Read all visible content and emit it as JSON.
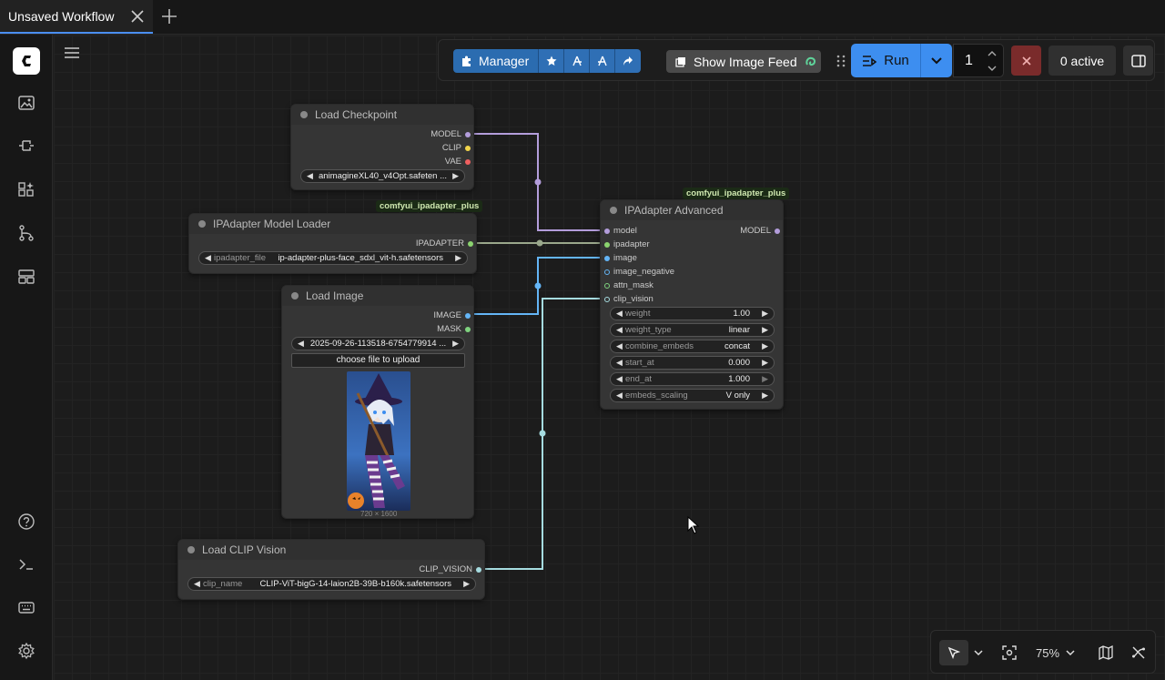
{
  "tab": {
    "title": "Unsaved Workflow"
  },
  "toolbar": {
    "manager_label": "Manager",
    "feed_label": "Show Image Feed",
    "run_label": "Run",
    "run_count": "1",
    "active_label": "0 active"
  },
  "zoom": {
    "label": "75%"
  },
  "nodes": {
    "checkpoint": {
      "title": "Load Checkpoint",
      "outputs": [
        "MODEL",
        "CLIP",
        "VAE"
      ],
      "ckpt_value": "animagineXL40_v4Opt.safeten ..."
    },
    "ipa_loader": {
      "badge": "comfyui_ipadapter_plus",
      "title": "IPAdapter Model Loader",
      "output": "IPADAPTER",
      "widget_name": "ipadapter_file",
      "widget_value": "ip-adapter-plus-face_sdxl_vit-h.safetensors"
    },
    "load_image": {
      "title": "Load Image",
      "outputs": [
        "IMAGE",
        "MASK"
      ],
      "file_value": "2025-09-26-113518-6754779914 ...",
      "upload_label": "choose file to upload",
      "image_size": "720 × 1600"
    },
    "clip_vision": {
      "title": "Load CLIP Vision",
      "output": "CLIP_VISION",
      "widget_name": "clip_name",
      "widget_value": "CLIP-ViT-bigG-14-laion2B-39B-b160k.safetensors"
    },
    "ipa_advanced": {
      "badge": "comfyui_ipadapter_plus",
      "title": "IPAdapter Advanced",
      "inputs": [
        "model",
        "ipadapter",
        "image",
        "image_negative",
        "attn_mask",
        "clip_vision"
      ],
      "output": "MODEL",
      "widgets": [
        {
          "name": "weight",
          "value": "1.00"
        },
        {
          "name": "weight_type",
          "value": "linear"
        },
        {
          "name": "combine_embeds",
          "value": "concat"
        },
        {
          "name": "start_at",
          "value": "0.000"
        },
        {
          "name": "end_at",
          "value": "1.000"
        },
        {
          "name": "embeds_scaling",
          "value": "V only"
        }
      ]
    }
  },
  "colors": {
    "model": "#b39ddb",
    "clip": "#f2d54b",
    "vae": "#f06060",
    "ipadapter": "#8bd36f",
    "image": "#64b5f6",
    "mask": "#7fd37f",
    "clip_vision": "#a6dce0",
    "accent": "#3d8ef0"
  }
}
